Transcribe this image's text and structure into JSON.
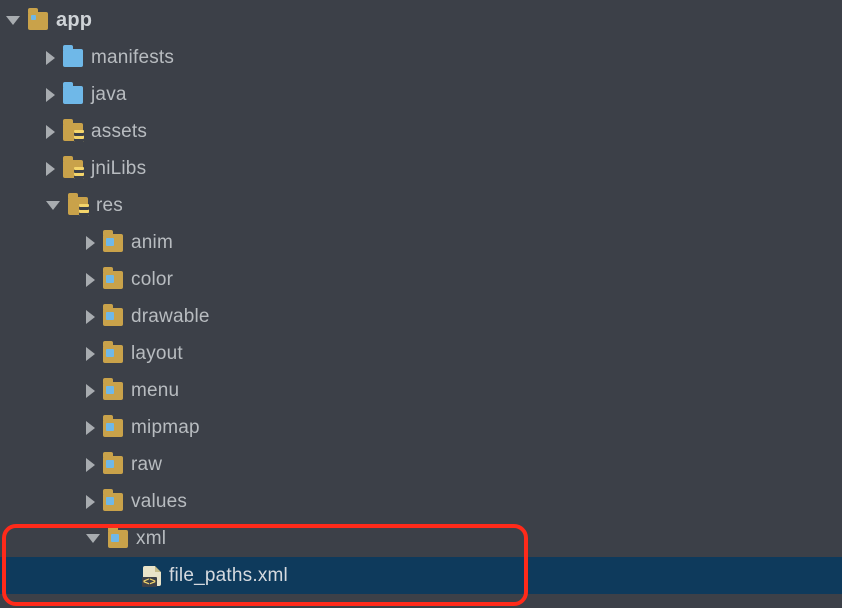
{
  "tree": {
    "app": {
      "label": "app",
      "manifests": {
        "label": "manifests"
      },
      "java": {
        "label": "java"
      },
      "assets": {
        "label": "assets"
      },
      "jniLibs": {
        "label": "jniLibs"
      },
      "res": {
        "label": "res",
        "anim": {
          "label": "anim"
        },
        "color": {
          "label": "color"
        },
        "drawable": {
          "label": "drawable"
        },
        "layout": {
          "label": "layout"
        },
        "menu": {
          "label": "menu"
        },
        "mipmap": {
          "label": "mipmap"
        },
        "raw": {
          "label": "raw"
        },
        "values": {
          "label": "values"
        },
        "xml": {
          "label": "xml",
          "file_paths": {
            "label": "file_paths.xml"
          }
        }
      }
    }
  }
}
